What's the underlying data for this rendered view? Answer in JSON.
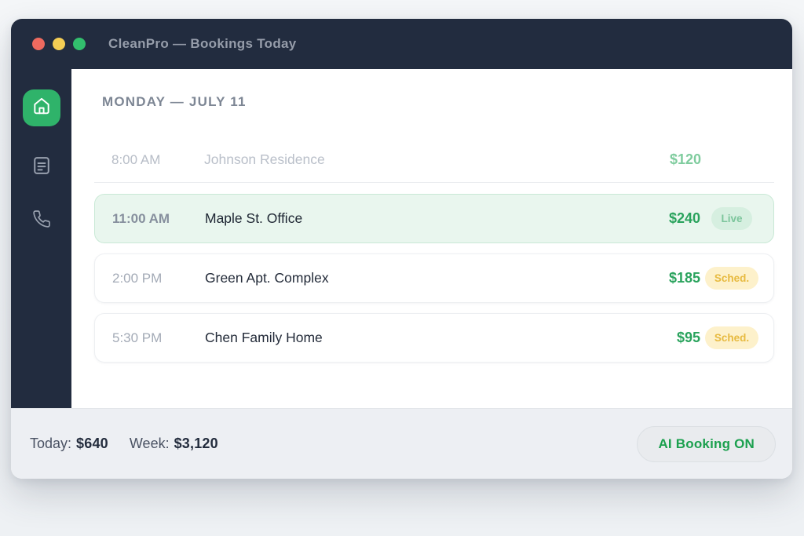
{
  "window": {
    "title": "CleanPro — Bookings Today"
  },
  "sidebar": {
    "items": [
      {
        "id": "home",
        "icon": "home-icon",
        "active": true
      },
      {
        "id": "bookings",
        "icon": "list-icon",
        "active": false
      },
      {
        "id": "calls",
        "icon": "phone-icon",
        "active": false
      }
    ]
  },
  "main": {
    "date_header": "MONDAY — JULY 11",
    "bookings": [
      {
        "time": "8:00 AM",
        "client": "Johnson Residence",
        "price": "$120",
        "badge": "",
        "status": "past"
      },
      {
        "time": "11:00 AM",
        "client": "Maple St. Office",
        "price": "$240",
        "badge": "Live",
        "status": "live"
      },
      {
        "time": "2:00 PM",
        "client": "Green Apt. Complex",
        "price": "$185",
        "badge": "Sched.",
        "status": "scheduled"
      },
      {
        "time": "5:30 PM",
        "client": "Chen Family Home",
        "price": "$95",
        "badge": "Sched.",
        "status": "scheduled"
      }
    ]
  },
  "footer": {
    "today_label": "Today:",
    "today_value": "$640",
    "week_label": "Week:",
    "week_value": "$3,120",
    "ai_button_label": "AI Booking ON"
  },
  "colors": {
    "titlebar_bg": "#222c3f",
    "sidebar_bg": "#222c3f",
    "accent_green": "#2fb36a",
    "price_green": "#2aa35d",
    "live_badge_bg": "#d6efe0",
    "live_badge_text": "#7cc59b",
    "sched_badge_bg": "#fdf1cb",
    "sched_badge_text": "#e7ba40",
    "highlight_row_bg": "#e9f6ee",
    "footer_bg": "#edeff3",
    "traffic_red": "#ee6a5f",
    "traffic_yellow": "#f5ce54",
    "traffic_green": "#32bf6d"
  }
}
